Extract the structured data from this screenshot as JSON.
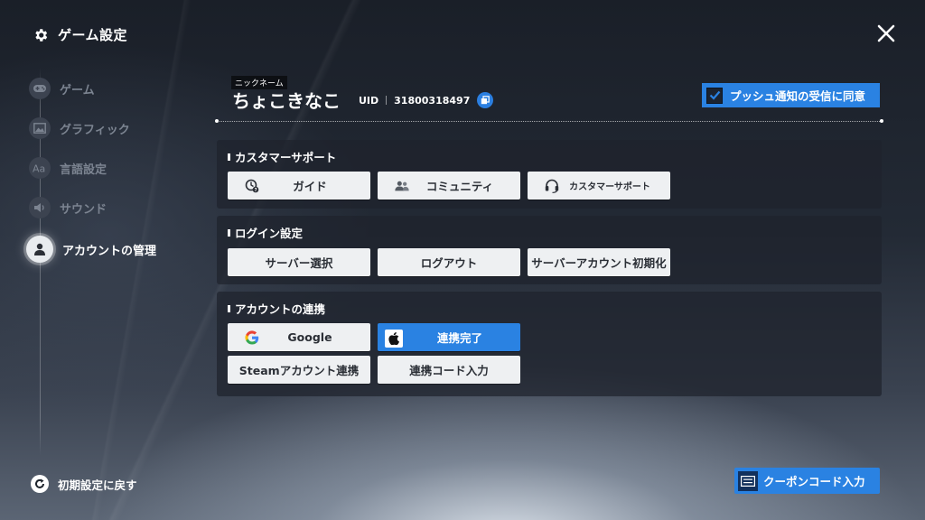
{
  "header": {
    "title": "ゲーム設定",
    "close_icon": "close-icon"
  },
  "sidebar": {
    "items": [
      {
        "label": "ゲーム",
        "icon": "gamepad-icon"
      },
      {
        "label": "グラフィック",
        "icon": "image-icon"
      },
      {
        "label": "言語設定",
        "icon": "font-aa-icon"
      },
      {
        "label": "サウンド",
        "icon": "speaker-icon"
      },
      {
        "label": "アカウントの管理",
        "icon": "user-icon",
        "active": true
      }
    ],
    "reset_label": "初期設定に戻す"
  },
  "profile": {
    "nickname_label": "ニックネーム",
    "nickname": "ちょこきなこ",
    "uid_label": "UID",
    "uid": "31800318497"
  },
  "push": {
    "label": "プッシュ通知の受信に同意",
    "checked": true
  },
  "sections": {
    "support": {
      "title": "カスタマーサポート",
      "guide": "ガイド",
      "community": "コミュニティ",
      "customer_support": "カスタマーサポート"
    },
    "login": {
      "title": "ログイン設定",
      "server_select": "サーバー選択",
      "logout": "ログアウト",
      "server_reset": "サーバーアカウント初期化"
    },
    "link": {
      "title": "アカウントの連携",
      "google": "Google",
      "apple_done": "連携完了",
      "steam": "Steamアカウント連携",
      "link_code": "連携コード入力"
    }
  },
  "coupon": {
    "label": "クーポンコード入力"
  },
  "colors": {
    "accent": "#2a82e2",
    "button_bg": "#eef0f2",
    "panel_bg": "#1e232c"
  }
}
